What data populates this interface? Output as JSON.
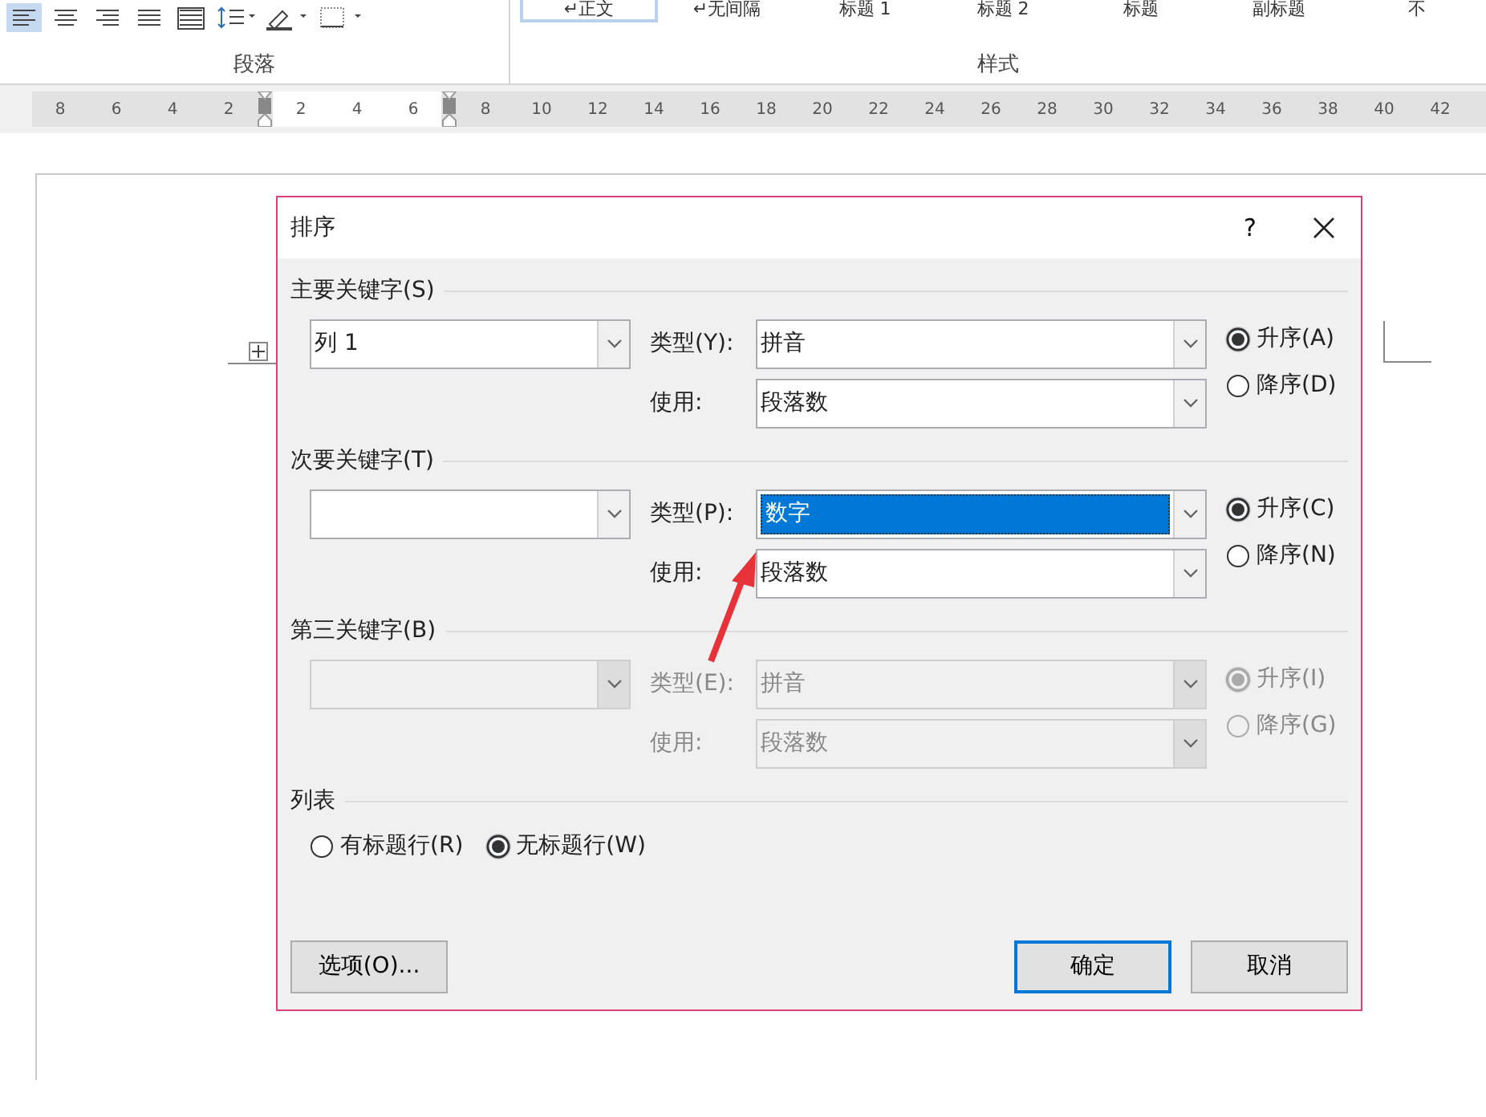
{
  "ribbon": {
    "paragraph_group": {
      "label": "段落"
    },
    "styles_group": {
      "label": "样式",
      "styles": [
        {
          "name": "↵正文",
          "selected": true
        },
        {
          "name": "↵无间隔",
          "selected": false
        },
        {
          "name": "标题 1",
          "selected": false
        },
        {
          "name": "标题 2",
          "selected": false
        },
        {
          "name": "标题",
          "selected": false
        },
        {
          "name": "副标题",
          "selected": false
        },
        {
          "name": "不",
          "selected": false
        }
      ]
    }
  },
  "ruler": {
    "segments": [
      {
        "kind": "margin",
        "ticks": [
          "8",
          "6",
          "4",
          "2"
        ]
      },
      {
        "kind": "text",
        "ticks": [
          "2",
          "4",
          "6"
        ]
      },
      {
        "kind": "margin",
        "ticks": [
          "8",
          "10",
          "12",
          "14",
          "16",
          "18",
          "20",
          "22",
          "24",
          "26",
          "28",
          "30",
          "32",
          "34",
          "36",
          "38",
          "40",
          "42"
        ]
      }
    ]
  },
  "dialog": {
    "title": "排序",
    "help": "?",
    "keys": [
      {
        "heading": "主要关键字(S)",
        "disabled": false,
        "column": "列 1",
        "type_label": "类型(Y):",
        "type_value": "拼音",
        "type_highlighted": false,
        "use_label": "使用:",
        "use_value": "段落数",
        "order": [
          {
            "label": "升序(A)",
            "selected": true
          },
          {
            "label": "降序(D)",
            "selected": false
          }
        ]
      },
      {
        "heading": "次要关键字(T)",
        "disabled": false,
        "type_label": "类型(P):",
        "type_value": "数字",
        "type_highlighted": true,
        "use_label": "使用:",
        "use_value": "段落数",
        "order": [
          {
            "label": "升序(C)",
            "selected": true
          },
          {
            "label": "降序(N)",
            "selected": false
          }
        ]
      },
      {
        "heading": "第三关键字(B)",
        "disabled": true,
        "type_label": "类型(E):",
        "type_value": "拼音",
        "type_highlighted": false,
        "use_label": "使用:",
        "use_value": "段落数",
        "order": [
          {
            "label": "升序(I)",
            "selected": true
          },
          {
            "label": "降序(G)",
            "selected": false
          }
        ]
      }
    ],
    "list": {
      "heading": "列表",
      "options": [
        {
          "label": "有标题行(R)",
          "selected": false
        },
        {
          "label": "无标题行(W)",
          "selected": true
        }
      ]
    },
    "buttons": [
      {
        "label": "选项(O)...",
        "default": false
      },
      {
        "label": "确定",
        "default": true
      },
      {
        "label": "取消",
        "default": false
      }
    ]
  }
}
